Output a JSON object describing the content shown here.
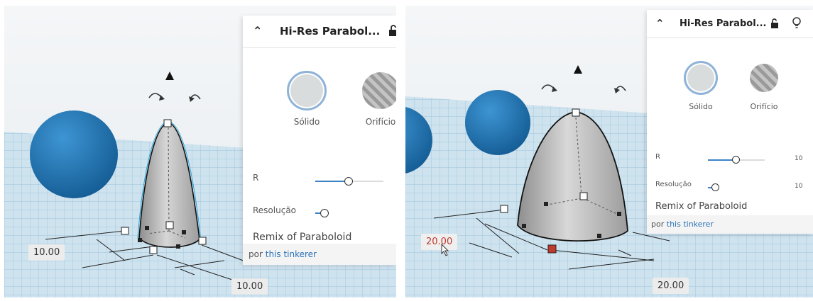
{
  "colors": {
    "accent": "#3b82c4",
    "sphere": "#1f77b8",
    "grid_bg": "#d4e6f1",
    "active_value": "#c0392b"
  },
  "left": {
    "panel": {
      "collapse_icon": "chevron-up-icon",
      "title": "Hi-Res Parabol...",
      "lock_icon": "unlocked-padlock-icon",
      "solid_label": "Sólido",
      "hole_label": "Orifício",
      "r_label": "R",
      "res_label": "Resolução",
      "remix": "Remix of Paraboloid",
      "by_prefix": "por",
      "author": "this tinkerer"
    },
    "dims": {
      "left_value": "10.00",
      "bottom_value": "10.00"
    },
    "sliders": {
      "r_fraction": 0.48,
      "res_fraction": 0.05
    }
  },
  "right": {
    "panel": {
      "collapse_icon": "chevron-up-icon",
      "title": "Hi-Res Parabol...",
      "lock_icon": "unlocked-padlock-icon",
      "light_icon": "lightbulb-icon",
      "solid_label": "Sólido",
      "hole_label": "Orifício",
      "r_label": "R",
      "r_value": "10",
      "res_label": "Resolução",
      "res_value": "10",
      "remix": "Remix of Paraboloid",
      "by_prefix": "por",
      "author": "this tinkerer"
    },
    "dims": {
      "left_value": "20.00",
      "bottom_value": "20.00"
    },
    "sliders": {
      "r_fraction": 0.48,
      "res_fraction": 0.05
    }
  }
}
